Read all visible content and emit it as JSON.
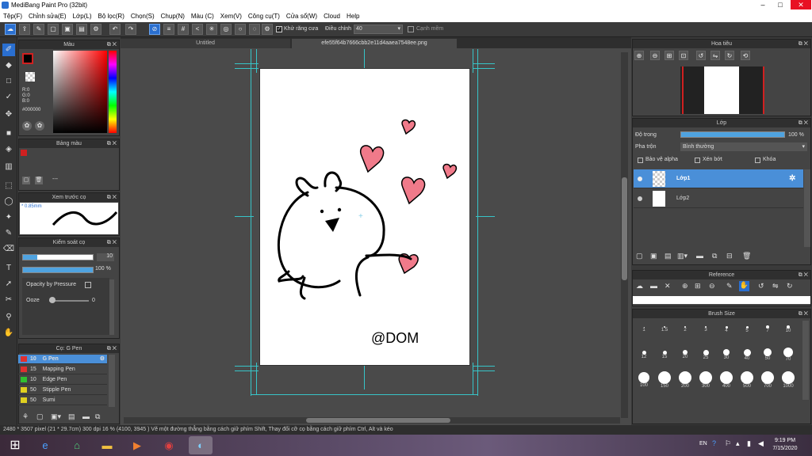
{
  "window": {
    "title": "MediBang Paint Pro (32bit)"
  },
  "menu": [
    "Tệp(F)",
    "Chỉnh sửa(E)",
    "Lớp(L)",
    "Bộ lọc(R)",
    "Chọn(S)",
    "Chụp(N)",
    "Màu (C)",
    "Xem(V)",
    "Công cụ(T)",
    "Cửa sổ(W)",
    "Cloud",
    "Help"
  ],
  "toolbar": {
    "antialias_label": "Khử răng cưa",
    "adjust_label": "Điều chỉnh",
    "adjust_value": "40",
    "smooth_label": "Cạnh mềm"
  },
  "tabs": [
    "Untitled",
    "efe55f64b7666cbb2e11d4aaea7548ee.png"
  ],
  "color_panel": {
    "title": "Màu",
    "r": "R:0",
    "g": "G:0",
    "b": "B:0",
    "hex": "#000000",
    "fg_color": "#000000",
    "bg_color": "#ffffff"
  },
  "palette_panel": {
    "title": "Bảng màu",
    "dash": "---"
  },
  "brush_preview": {
    "title": "Xem trước cọ",
    "size": "* 0.85mm"
  },
  "brush_control": {
    "title": "Kiểm soát cọ",
    "size_value": "10",
    "opacity_value": "100 %",
    "opacity_pressure": "Opacity by Pressure",
    "ooze": "Ooze",
    "ooze_value": "0"
  },
  "pen_list": {
    "title": "Cọ: G Pen",
    "items": [
      {
        "size": "10",
        "name": "G Pen",
        "color": "#e03030",
        "selected": true
      },
      {
        "size": "15",
        "name": "Mapping Pen",
        "color": "#e03030",
        "selected": false
      },
      {
        "size": "10",
        "name": "Edge Pen",
        "color": "#30c030",
        "selected": false
      },
      {
        "size": "50",
        "name": "Stipple Pen",
        "color": "#e0d020",
        "selected": false
      },
      {
        "size": "50",
        "name": "Sumi",
        "color": "#e0d020",
        "selected": false
      }
    ]
  },
  "navigator": {
    "title": "Hoa tiêu"
  },
  "layer_panel": {
    "title": "Lớp",
    "opacity_label": "Độ trong",
    "opacity_value": "100 %",
    "blend_label": "Pha trộn",
    "blend_value": "Bình thường",
    "protect_alpha": "Bảo vệ alpha",
    "clipping": "Xén bớt",
    "lock": "Khóa",
    "layers": [
      "Lớp1",
      "Lớp2"
    ]
  },
  "reference_panel": {
    "title": "Reference"
  },
  "brush_size_panel": {
    "title": "Brush Size",
    "sizes": [
      "1",
      "1.5",
      "2",
      "3",
      "4",
      "5",
      "7",
      "10",
      "12",
      "15",
      "20",
      "25",
      "30",
      "40",
      "50",
      "70",
      "100",
      "150",
      "200",
      "300",
      "400",
      "500",
      "700",
      "1000"
    ]
  },
  "canvas": {
    "signature": "@DOM"
  },
  "status": "2480 * 3507 pixel  (21 * 29.7cm)  300 dpi  16 %  (4100, 3945 )  Vẽ một đường thẳng bằng cách giữ phím Shift, Thay đổi cỡ cọ bằng cách giữ phím Ctrl, Alt và kéo",
  "taskbar": {
    "lang": "EN",
    "time": "9:19 PM",
    "date": "7/15/2020"
  }
}
